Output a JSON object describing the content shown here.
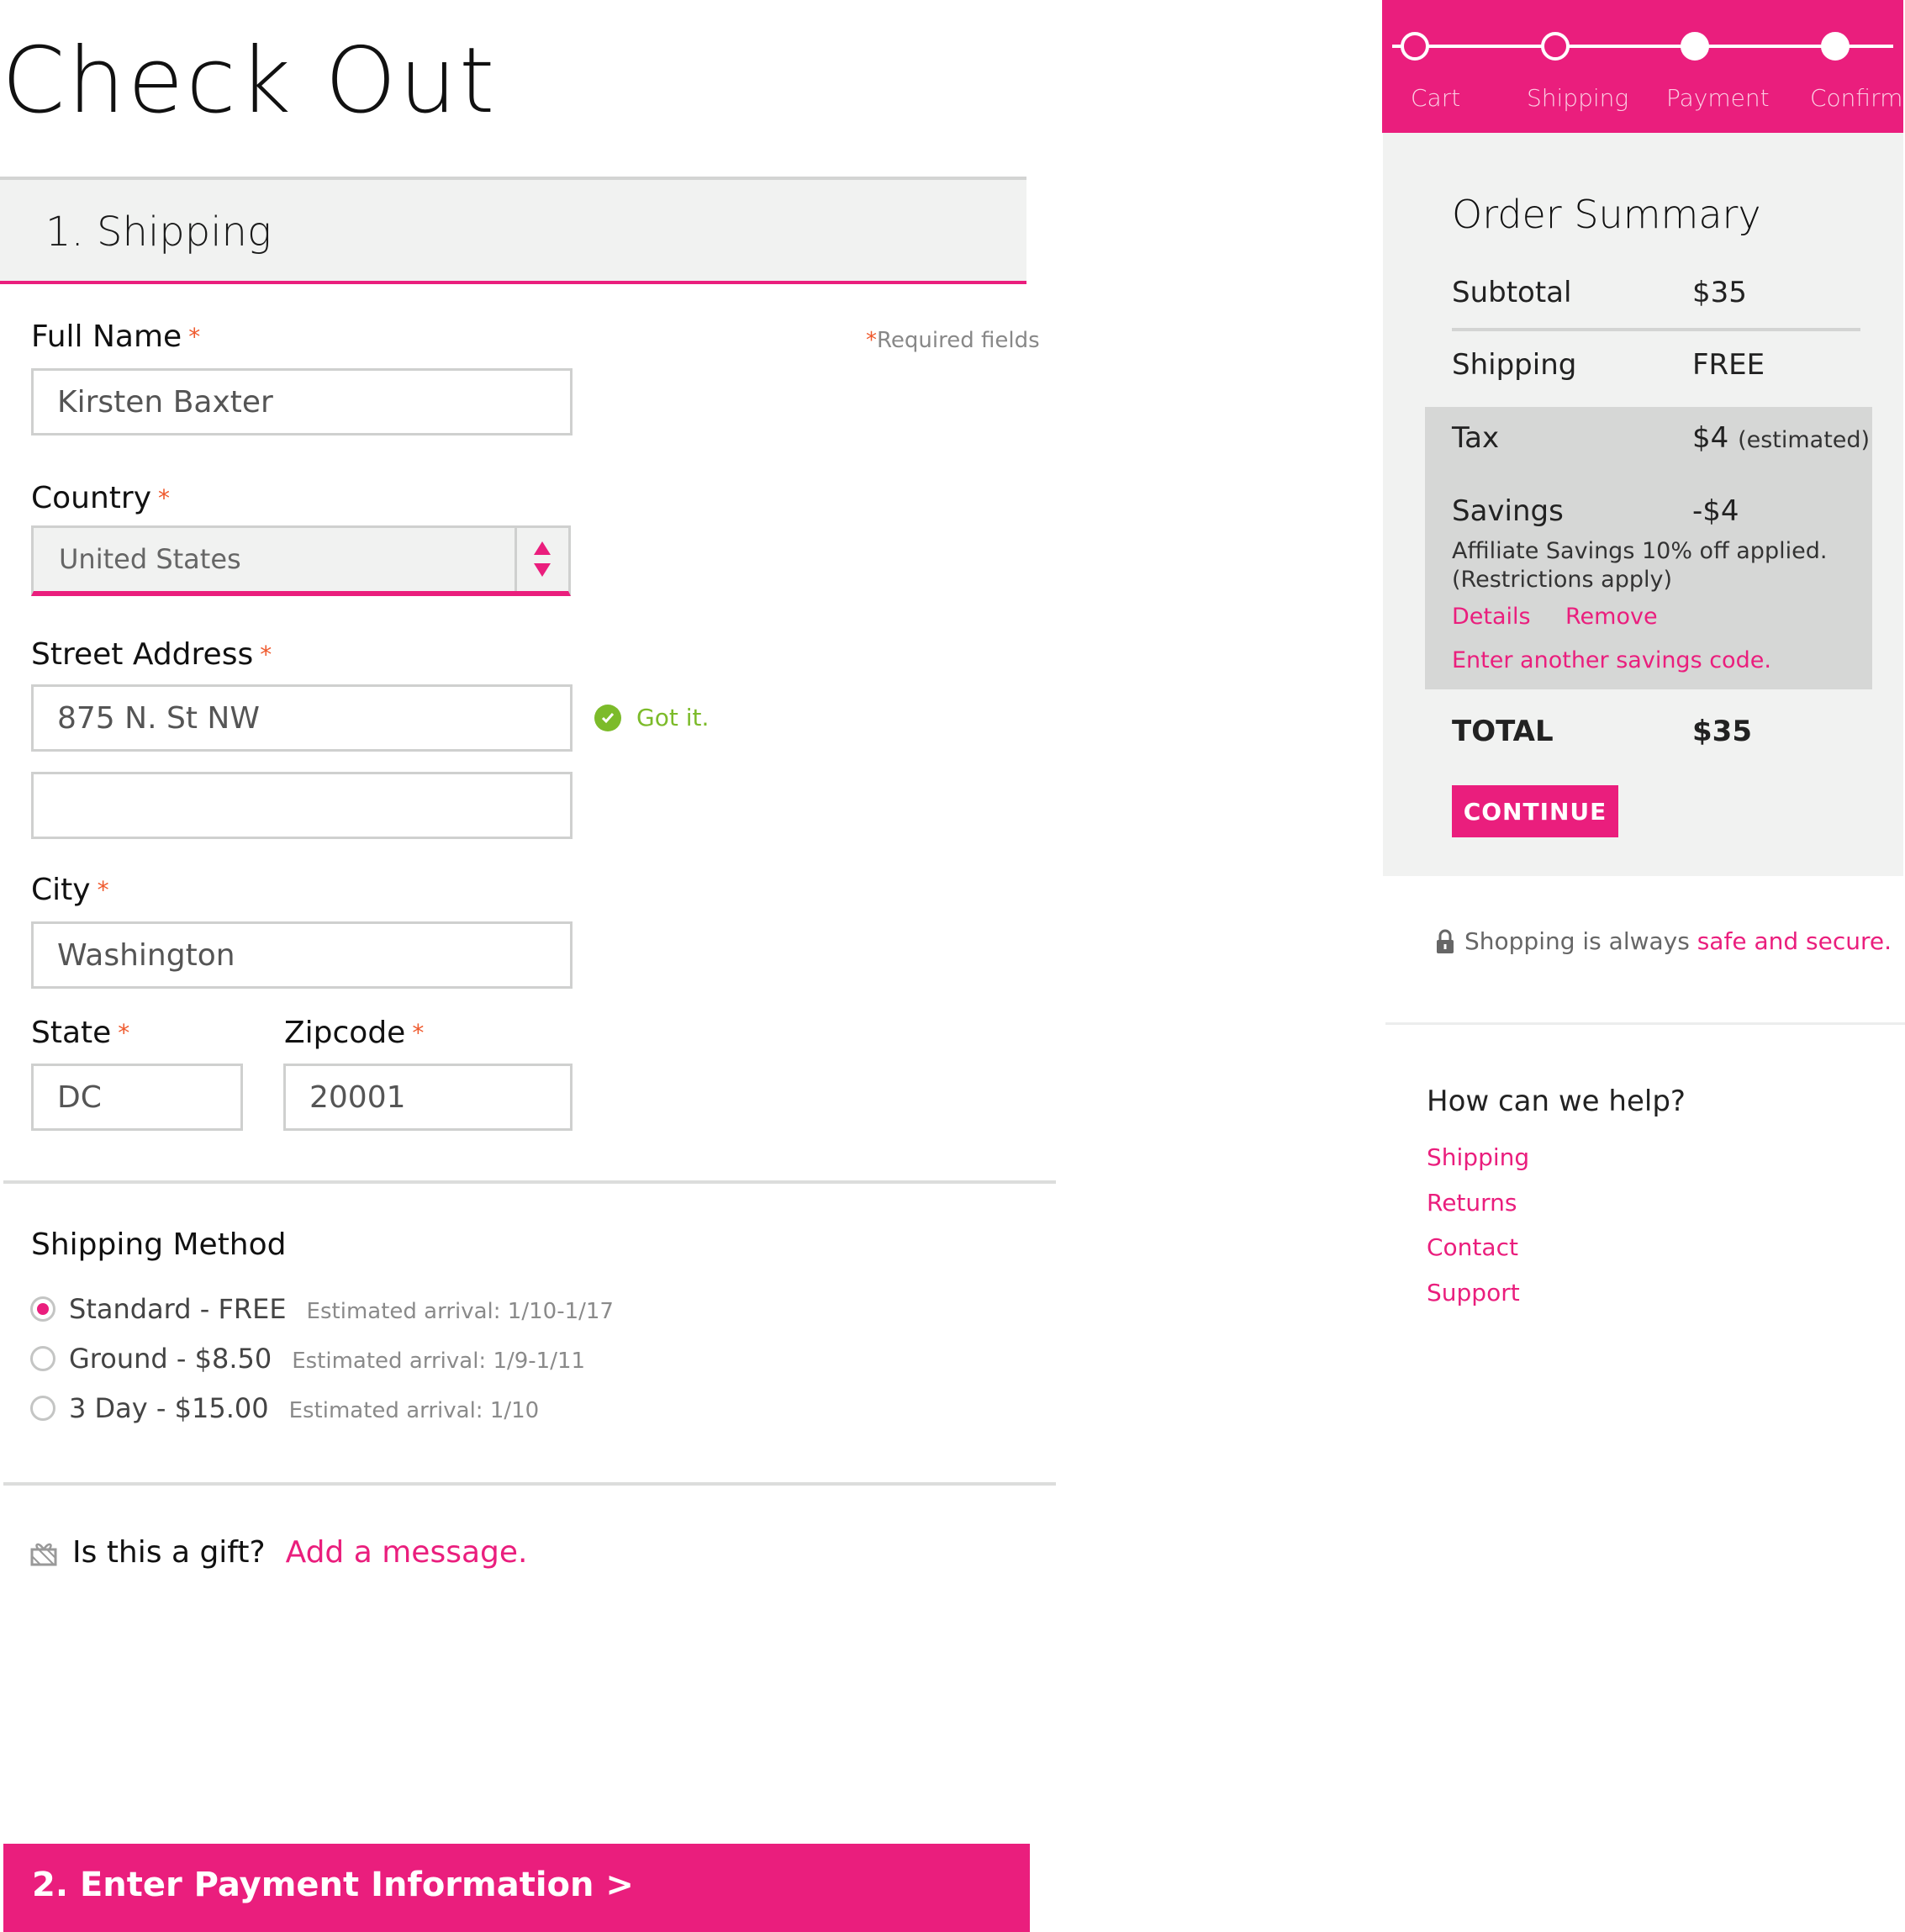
{
  "page_title": "Check Out",
  "section": {
    "title": "1. Shipping"
  },
  "required_note": {
    "star": "*",
    "text": "Required fields"
  },
  "form": {
    "full_name": {
      "label": "Full Name",
      "value": "Kirsten Baxter"
    },
    "country": {
      "label": "Country",
      "value": "United States"
    },
    "street": {
      "label": "Street Address",
      "value": "875 N. St NW",
      "value2": "",
      "validation": "Got it."
    },
    "city": {
      "label": "City",
      "value": "Washington"
    },
    "state": {
      "label": "State",
      "value": "DC"
    },
    "zip": {
      "label": "Zipcode",
      "value": "20001"
    },
    "required_mark": "*"
  },
  "shipping_method": {
    "title": "Shipping Method",
    "options": [
      {
        "label": "Standard - FREE",
        "eta": "Estimated arrival: 1/10-1/17",
        "selected": true
      },
      {
        "label": "Ground - $8.50",
        "eta": "Estimated arrival: 1/9-1/11",
        "selected": false
      },
      {
        "label": "3 Day - $15.00",
        "eta": "Estimated arrival: 1/10",
        "selected": false
      }
    ]
  },
  "gift": {
    "question": "Is this a gift?",
    "link": "Add a message."
  },
  "payment_bar": {
    "label": "2. Enter Payment Information  >"
  },
  "progress": {
    "steps": [
      {
        "label": "Cart",
        "done": false
      },
      {
        "label": "Shipping",
        "done": false
      },
      {
        "label": "Payment",
        "done": true
      },
      {
        "label": "Confirm",
        "done": true
      }
    ]
  },
  "summary": {
    "title": "Order Summary",
    "subtotal_label": "Subtotal",
    "subtotal": "$35",
    "shipping_label": "Shipping",
    "shipping": "FREE",
    "tax_label": "Tax",
    "tax": "$4",
    "tax_note": "(estimated)",
    "savings_label": "Savings",
    "savings": "-$4",
    "savings_note1": "Affiliate Savings 10% off applied.",
    "savings_note2": "(Restrictions apply)",
    "details_link": "Details",
    "remove_link": "Remove",
    "another_code": "Enter another savings code.",
    "total_label": "TOTAL",
    "total": "$35",
    "continue_label": "CONTINUE"
  },
  "secure": {
    "text": "Shopping is always ",
    "link": "safe and secure."
  },
  "help": {
    "title": "How can we help?",
    "links": [
      "Shipping",
      "Returns",
      "Contact",
      "Support"
    ]
  },
  "colors": {
    "accent": "#ea1e7d",
    "success": "#7cbb2a",
    "panel": "#f1f2f1"
  },
  "icons": [
    "chevron-up-down-icon",
    "check-circle-icon",
    "gift-icon",
    "lock-icon"
  ]
}
